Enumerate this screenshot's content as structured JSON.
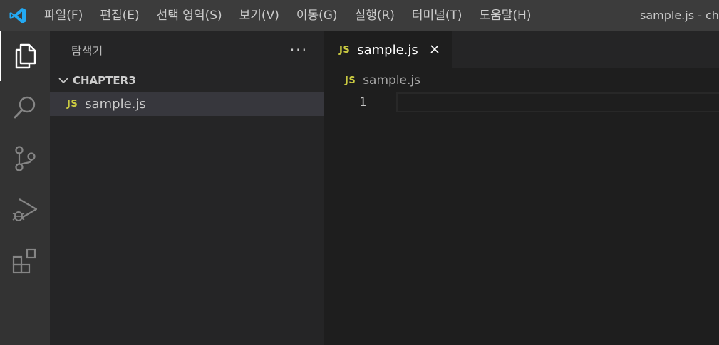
{
  "menu": [
    "파일(F)",
    "편집(E)",
    "선택 영역(S)",
    "보기(V)",
    "이동(G)",
    "실행(R)",
    "터미널(T)",
    "도움말(H)"
  ],
  "window_title": "sample.js - cha",
  "sidebar": {
    "title": "탐색기",
    "more": "···",
    "folder": "CHAPTER3",
    "files": [
      {
        "badge": "JS",
        "name": "sample.js"
      }
    ]
  },
  "editor": {
    "tab": {
      "badge": "JS",
      "name": "sample.js"
    },
    "breadcrumb": {
      "badge": "JS",
      "name": "sample.js"
    },
    "line_numbers": [
      "1"
    ]
  },
  "colors": {
    "accent": "#0078d4",
    "js_badge": "#cbcb41"
  },
  "icons": [
    "vscode-logo-icon",
    "explorer-icon",
    "search-icon",
    "source-control-icon",
    "run-debug-icon",
    "extensions-icon",
    "chevron-down-icon",
    "close-icon"
  ]
}
